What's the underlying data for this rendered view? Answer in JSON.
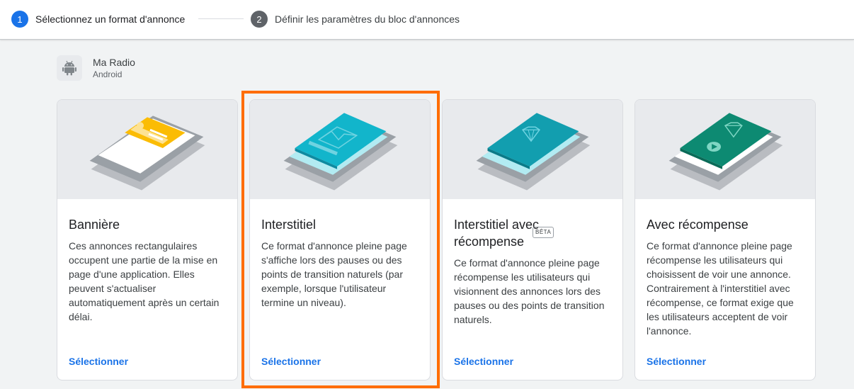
{
  "stepper": {
    "step1": {
      "number": "1",
      "label": "Sélectionnez un format d'annonce"
    },
    "step2": {
      "number": "2",
      "label": "Définir les paramètres du bloc d'annonces"
    }
  },
  "app": {
    "name": "Ma Radio",
    "platform": "Android",
    "icon": "android-icon"
  },
  "cards": [
    {
      "title": "Bannière",
      "description": "Ces annonces rectangulaires occupent une partie de la mise en page d'une application. Elles peuvent s'actualiser automatiquement après un certain délai.",
      "select_label": "Sélectionner"
    },
    {
      "title": "Interstitiel",
      "description": "Ce format d'annonce pleine page s'affiche lors des pauses ou des points de transition naturels (par exemple, lorsque l'utilisateur termine un niveau).",
      "select_label": "Sélectionner"
    },
    {
      "title": "Interstitiel avec récompense",
      "badge": "BÊTA",
      "description": "Ce format d'annonce pleine page récompense les utilisateurs qui visionnent des annonces lors des pauses ou des points de transition naturels.",
      "select_label": "Sélectionner"
    },
    {
      "title": "Avec récompense",
      "description": "Ce format d'annonce pleine page récompense les utilisateurs qui choisissent de voir une annonce. Contrairement à l'interstitiel avec récompense, ce format exige que les utilisateurs acceptent de voir l'annonce.",
      "select_label": "Sélectionner"
    }
  ],
  "colors": {
    "accent": "#1a73e8",
    "highlight": "#ff6d00",
    "banner": "#fbbc04",
    "interstitial": "#12b5cb",
    "rewarded_interstitial": "#129eaf",
    "rewarded": "#0d8a72"
  }
}
